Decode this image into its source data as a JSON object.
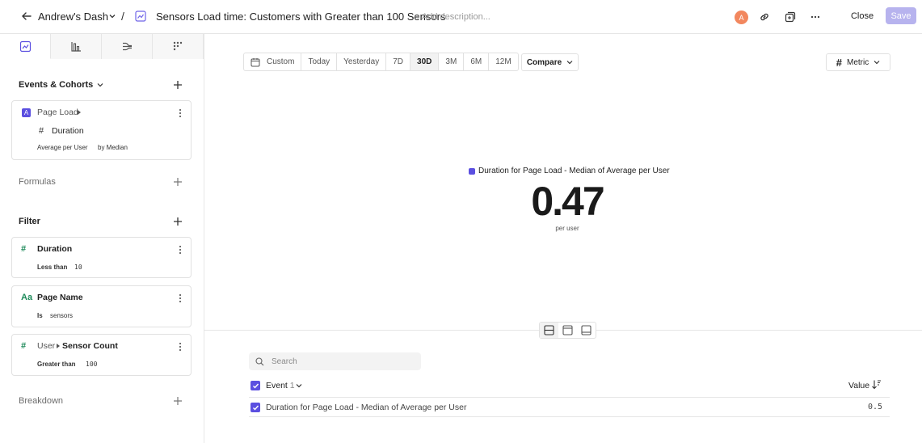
{
  "header": {
    "dashboard_name": "Andrew's Dash",
    "separator": "/",
    "report_title": "Sensors Load time: Customers with Greater than 100 Sensors",
    "add_description": "+ Add description...",
    "avatar_initial": "A",
    "close_label": "Close",
    "save_label": "Save"
  },
  "sidebar": {
    "tabs": [
      "insights-icon",
      "funnels-icon",
      "flows-icon",
      "retention-icon"
    ],
    "events_section": "Events & Cohorts",
    "event_card": {
      "letter": "A",
      "event_name": "Page Load",
      "property": "Duration",
      "aggregation": "Average per User",
      "by": "by Median"
    },
    "formulas_section": "Formulas",
    "filter_section": "Filter",
    "filters": [
      {
        "type_icon": "#",
        "property": "Duration",
        "operator": "Less than",
        "value": "10"
      },
      {
        "type_icon": "Aa",
        "property": "Page Name",
        "operator": "Is",
        "value": "sensors"
      },
      {
        "type_icon": "#",
        "parent": "User",
        "property": "Sensor Count",
        "operator": "Greater than",
        "value": "100"
      }
    ],
    "breakdown_section": "Breakdown"
  },
  "toolbar": {
    "ranges": [
      "Custom",
      "Today",
      "Yesterday",
      "7D",
      "30D",
      "3M",
      "6M",
      "12M"
    ],
    "active_range": "30D",
    "compare_label": "Compare",
    "metric_label": "Metric"
  },
  "metric": {
    "legend": "Duration for Page Load - Median of Average per User",
    "value": "0.47",
    "unit": "per user",
    "accent_color": "#5b4fe0"
  },
  "table": {
    "search_placeholder": "Search",
    "column_event_label": "Event",
    "column_event_num": "1",
    "column_value_label": "Value",
    "rows": [
      {
        "label": "Duration for Page Load - Median of Average per User",
        "value": "0.5"
      }
    ]
  }
}
